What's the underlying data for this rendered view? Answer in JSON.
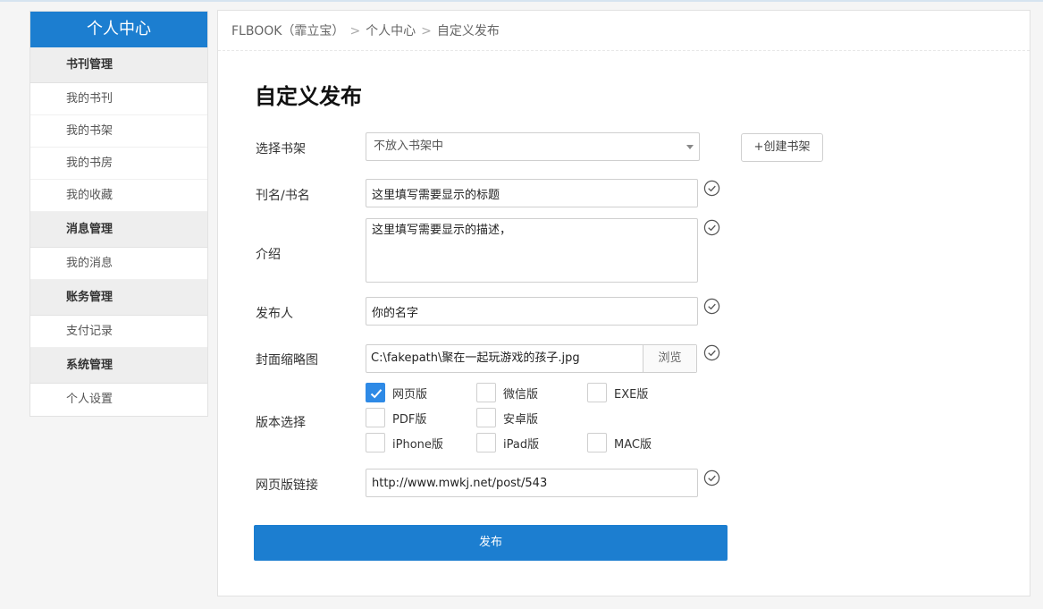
{
  "sidebar": {
    "title": "个人中心",
    "groups": [
      {
        "header": "书刊管理",
        "items": [
          "我的书刊",
          "我的书架",
          "我的书房",
          "我的收藏"
        ]
      },
      {
        "header": "消息管理",
        "items": [
          "我的消息"
        ]
      },
      {
        "header": "账务管理",
        "items": [
          "支付记录"
        ]
      },
      {
        "header": "系统管理",
        "items": [
          "个人设置"
        ]
      }
    ]
  },
  "breadcrumb": {
    "site": "FLBOOK（霏立宝）",
    "sep": ">",
    "level1": "个人中心",
    "level2": "自定义发布"
  },
  "page_title": "自定义发布",
  "form": {
    "bookshelf": {
      "label": "选择书架",
      "value": "不放入书架中",
      "create_label": "+创建书架"
    },
    "title": {
      "label": "刊名/书名",
      "value": "这里填写需要显示的标题"
    },
    "intro": {
      "label": "介绍",
      "value": "这里填写需要显示的描述，"
    },
    "publisher": {
      "label": "发布人",
      "value": "你的名字"
    },
    "cover": {
      "label": "封面缩略图",
      "value": "C:\\fakepath\\聚在一起玩游戏的孩子.jpg",
      "browse_label": "浏览"
    },
    "versions": {
      "label": "版本选择",
      "options": [
        {
          "label": "网页版",
          "checked": true
        },
        {
          "label": "微信版",
          "checked": false
        },
        {
          "label": "EXE版",
          "checked": false
        },
        {
          "label": "PDF版",
          "checked": false
        },
        {
          "label": "安卓版",
          "checked": false
        },
        {
          "label": "iPhone版",
          "checked": false
        },
        {
          "label": "iPad版",
          "checked": false
        },
        {
          "label": "MAC版",
          "checked": false
        }
      ]
    },
    "web_link": {
      "label": "网页版链接",
      "value": "http://www.mwkj.net/post/543"
    },
    "publish_label": "发布"
  },
  "colors": {
    "primary": "#1c7ed0",
    "checkbox_checked": "#2e8ae6"
  }
}
